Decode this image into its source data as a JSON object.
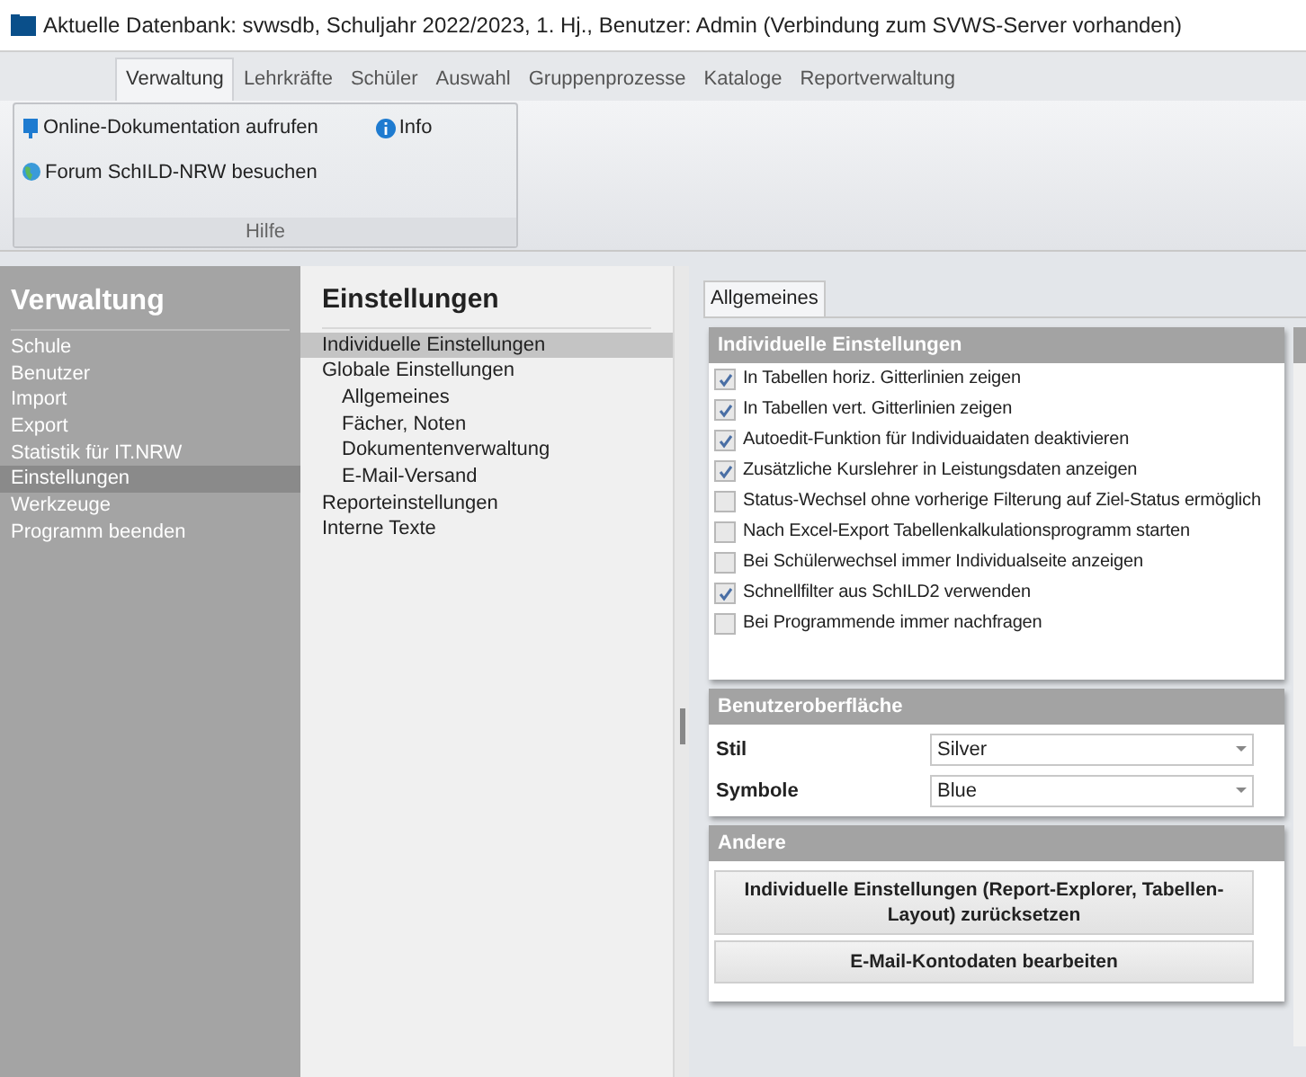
{
  "window": {
    "title": "Aktuelle Datenbank: svwsdb, Schuljahr 2022/2023, 1. Hj., Benutzer: Admin (Verbindung zum SVWS-Server vorhanden)"
  },
  "ribbon": {
    "tabs": [
      {
        "label": "Verwaltung",
        "selected": true
      },
      {
        "label": "Lehrkräfte",
        "selected": false
      },
      {
        "label": "Schüler",
        "selected": false
      },
      {
        "label": "Auswahl",
        "selected": false
      },
      {
        "label": "Gruppenprozesse",
        "selected": false
      },
      {
        "label": "Kataloge",
        "selected": false
      },
      {
        "label": "Reportverwaltung",
        "selected": false
      }
    ],
    "group": {
      "title": "Hilfe",
      "items": [
        {
          "label": "Online-Dokumentation aufrufen",
          "kind": "book"
        },
        {
          "label": "Info",
          "kind": "info"
        },
        {
          "label": "Forum SchILD-NRW besuchen",
          "kind": "globe"
        }
      ]
    }
  },
  "sidebar": {
    "title": "Verwaltung",
    "items": [
      {
        "label": "Schule",
        "selected": false
      },
      {
        "label": "Benutzer",
        "selected": false
      },
      {
        "label": "Import",
        "selected": false
      },
      {
        "label": "Export",
        "selected": false
      },
      {
        "label": "Statistik für IT.NRW",
        "selected": false
      },
      {
        "label": "Einstellungen",
        "selected": true
      },
      {
        "label": "Werkzeuge",
        "selected": false
      },
      {
        "label": "Programm beenden",
        "selected": false
      }
    ]
  },
  "navigation": {
    "title": "Einstellungen",
    "items": [
      {
        "label": "Individuelle Einstellungen",
        "selected": true
      },
      {
        "label": "Globale Einstellungen",
        "selected": false,
        "children": [
          {
            "label": "Allgemeines",
            "selected": false
          },
          {
            "label": "Fächer, Noten",
            "selected": false
          },
          {
            "label": "Dokumentenverwaltung",
            "selected": false
          },
          {
            "label": "E-Mail-Versand",
            "selected": false
          }
        ]
      },
      {
        "label": "Reporteinstellungen",
        "selected": false
      },
      {
        "label": "Interne Texte",
        "selected": false
      }
    ]
  },
  "content": {
    "tabs": [
      {
        "label": "Allgemeines",
        "selected": true
      }
    ],
    "individual": {
      "title": "Individuelle Einstellungen",
      "options": [
        {
          "label": "In Tabellen horiz. Gitterlinien zeigen",
          "checked": true
        },
        {
          "label": "In Tabellen vert. Gitterlinien zeigen",
          "checked": true
        },
        {
          "label": "Autoedit-Funktion für Individuaidaten deaktivieren",
          "checked": true
        },
        {
          "label": "Zusätzliche Kurslehrer in Leistungsdaten anzeigen",
          "checked": true
        },
        {
          "label": "Status-Wechsel ohne vorherige Filterung auf Ziel-Status ermöglich",
          "checked": false
        },
        {
          "label": "Nach Excel-Export Tabellenkalkulationsprogramm starten",
          "checked": false
        },
        {
          "label": "Bei Schülerwechsel immer Individualseite anzeigen",
          "checked": false
        },
        {
          "label": "Schnellfilter aus SchILD2 verwenden",
          "checked": true
        },
        {
          "label": "Bei Programmende immer nachfragen",
          "checked": false
        }
      ]
    },
    "ui": {
      "title": "Benutzeroberfläche",
      "fields": [
        {
          "label": "Stil",
          "value": "Silver"
        },
        {
          "label": "Symbole",
          "value": "Blue"
        }
      ]
    },
    "other": {
      "title": "Andere",
      "buttons": [
        "Individuelle Einstellungen (Report-Explorer, Tabellen-Layout) zurücksetzen",
        "E-Mail-Kontodaten bearbeiten"
      ]
    }
  }
}
